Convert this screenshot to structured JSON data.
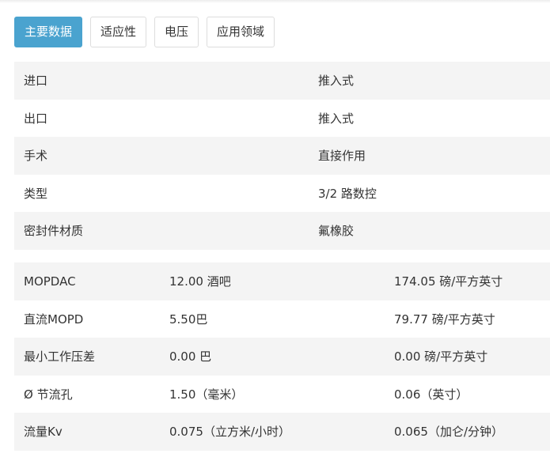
{
  "tabs": [
    {
      "label": "主要数据",
      "active": true
    },
    {
      "label": "适应性",
      "active": false
    },
    {
      "label": "电压",
      "active": false
    },
    {
      "label": "应用领域",
      "active": false
    }
  ],
  "general_table": [
    {
      "label": "进口",
      "value": "推入式"
    },
    {
      "label": "出口",
      "value": "推入式"
    },
    {
      "label": "手术",
      "value": "直接作用"
    },
    {
      "label": "类型",
      "value": "3/2 路数控"
    },
    {
      "label": "密封件材质",
      "value": "氟橡胶"
    }
  ],
  "spec_table": [
    {
      "label": "MOPDAC",
      "metric": "12.00 酒吧",
      "imperial": "174.05 磅/平方英寸"
    },
    {
      "label": "直流MOPD",
      "metric": "5.50巴",
      "imperial": "79.77 磅/平方英寸"
    },
    {
      "label": "最小工作压差",
      "metric": "0.00 巴",
      "imperial": "0.00 磅/平方英寸"
    },
    {
      "label": "Ø 节流孔",
      "metric": "1.50（毫米）",
      "imperial": "0.06（英寸）"
    },
    {
      "label": "流量Kv",
      "metric": "0.075（立方米/小时）",
      "imperial": "0.065（加仑/分钟）"
    }
  ],
  "colors": {
    "active_tab": "#4aa3cf",
    "row_stripe": "#f4f4f4",
    "text": "#333333"
  }
}
